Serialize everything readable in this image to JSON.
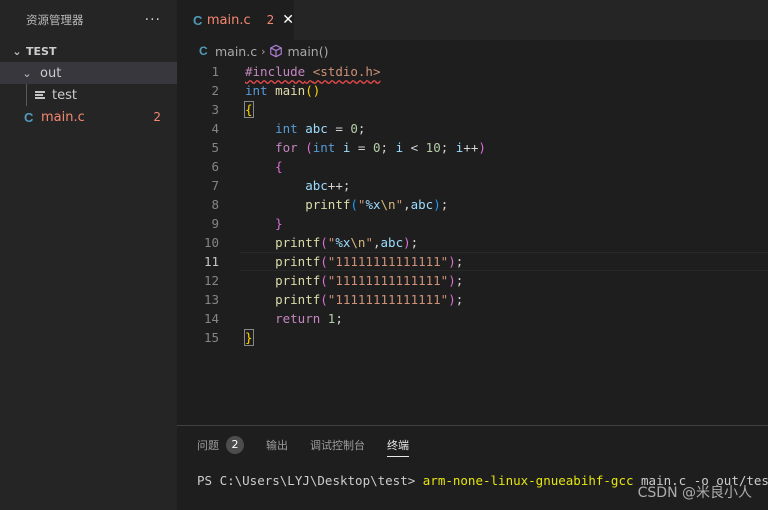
{
  "sidebar": {
    "title": "资源管理器",
    "more": "···",
    "section": "TEST",
    "items": [
      {
        "label": "out"
      },
      {
        "label": "test"
      },
      {
        "label": "main.c",
        "badge": "2"
      }
    ]
  },
  "editor": {
    "tab": {
      "icon": "C",
      "label": "main.c",
      "badge": "2",
      "close": "✕"
    },
    "breadcrumb": {
      "icon": "C",
      "file": "main.c",
      "sep": "›",
      "symbol": "main()"
    },
    "lines": [
      "1",
      "2",
      "3",
      "4",
      "5",
      "6",
      "7",
      "8",
      "9",
      "10",
      "11",
      "12",
      "13",
      "14",
      "15"
    ],
    "current_line": 11
  },
  "code": {
    "l1_pp": "#include",
    "l1_inc": "<stdio.h>",
    "l2_kw": "int",
    "l2_fn": "main",
    "l2_paren": "()",
    "l3": "{",
    "l4_kw": "int",
    "l4_var": "abc",
    "l4_eq": " = ",
    "l4_num": "0",
    "l4_end": ";",
    "l5_ctl": "for",
    "l5_p1": "(",
    "l5_kw": "int",
    "l5_i1": "i",
    "l5_eq": " = ",
    "l5_n0": "0",
    "l5_s1": "; ",
    "l5_i2": "i",
    "l5_lt": " < ",
    "l5_n10": "10",
    "l5_s2": "; ",
    "l5_i3": "i",
    "l5_pp": "++",
    "l5_p2": ")",
    "l6": "{",
    "l7_var": "abc",
    "l7_rest": "++;",
    "l8_fn": "printf",
    "l8_p1": "(",
    "l8_q1": "\"",
    "l8_fmt": "%x",
    "l8_esc": "\\n",
    "l8_q2": "\"",
    "l8_comma": ",",
    "l8_var": "abc",
    "l8_p2": ")",
    "l8_end": ";",
    "l9": "}",
    "l10_fn": "printf",
    "l10_p1": "(",
    "l10_q1": "\"",
    "l10_fmt": "%x",
    "l10_esc": "\\n",
    "l10_q2": "\"",
    "l10_comma": ",",
    "l10_var": "abc",
    "l10_p2": ")",
    "l10_end": ";",
    "l11_fn": "printf",
    "l11_p1": "(",
    "l11_str": "\"11111111111111\"",
    "l11_p2": ")",
    "l11_end": ";",
    "l12_fn": "printf",
    "l12_p1": "(",
    "l12_str": "\"11111111111111\"",
    "l12_p2": ")",
    "l12_end": ";",
    "l13_fn": "printf",
    "l13_p1": "(",
    "l13_str": "\"11111111111111\"",
    "l13_p2": ")",
    "l13_end": ";",
    "l14_ctl": "return",
    "l14_num": "1",
    "l14_end": ";",
    "l15": "}"
  },
  "panel": {
    "tabs": [
      "问题",
      "输出",
      "调试控制台",
      "终端"
    ],
    "problems_badge": "2",
    "active_tab": "终端",
    "terminal_prompt": "PS C:\\Users\\LYJ\\Desktop\\test> ",
    "terminal_cmd": "arm-none-linux-gnueabihf-gcc",
    "terminal_args": " main.c -o out/test"
  },
  "watermark": "CSDN @米良小人",
  "colors": {
    "error": "#f48771",
    "keyword": "#569cd6",
    "control": "#c586c0",
    "function": "#dcdcaa",
    "variable": "#9cdcfe",
    "string": "#ce9178",
    "number": "#b5cea8"
  }
}
